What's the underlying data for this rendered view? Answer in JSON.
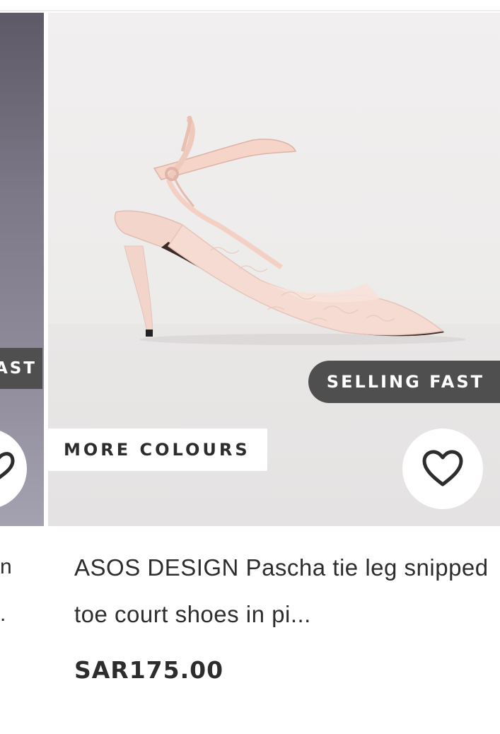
{
  "left_card": {
    "badge_label": "SELLING FAST",
    "title_line_1": "n",
    "title_line_2": "."
  },
  "product": {
    "badge_selling": "SELLING FAST",
    "badge_colours": "MORE COLOURS",
    "name": "ASOS DESIGN Pascha tie leg snipped toe court shoes in pi...",
    "price": "SAR175.00",
    "save_icon": "heart-icon"
  },
  "colors": {
    "badge_dark": "#4f4f4f",
    "text": "#2d2d2d",
    "shoe": "#f4d2c8"
  }
}
